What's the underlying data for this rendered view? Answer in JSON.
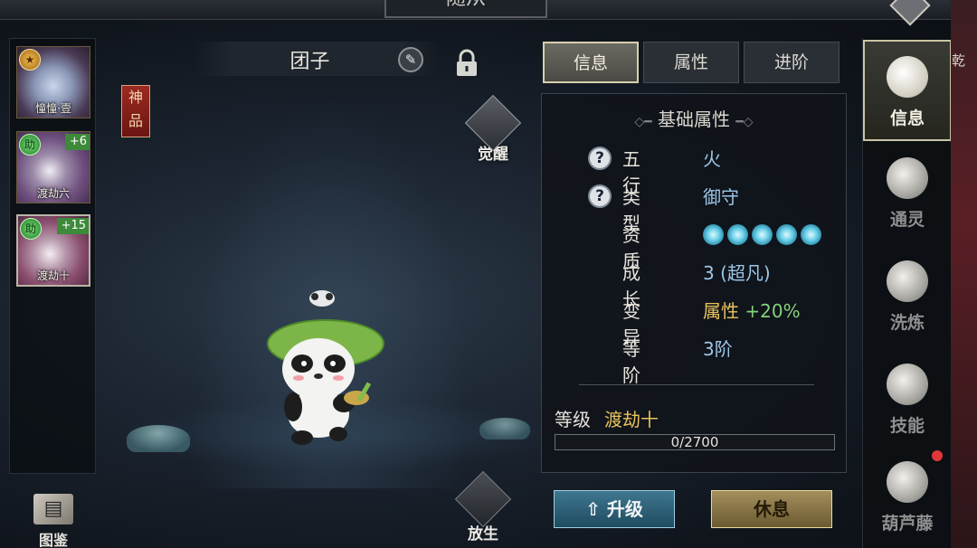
{
  "window_title": "随从",
  "pets": [
    {
      "name": "憧憧·壹",
      "plus": "",
      "badge": "icon-gold",
      "selected": false
    },
    {
      "name": "渡劫六",
      "plus": "+6",
      "badge": "助",
      "selected": false
    },
    {
      "name": "渡劫十",
      "plus": "+15",
      "badge": "助",
      "selected": true
    }
  ],
  "rank_tag": "神品",
  "pet_name": "团子",
  "awaken_label": "觉醒",
  "release_label": "放生",
  "atlas_label": "图鉴",
  "tabs": [
    {
      "label": "信息",
      "active": true
    },
    {
      "label": "属性",
      "active": false
    },
    {
      "label": "进阶",
      "active": false
    }
  ],
  "info": {
    "section_title": "基础属性",
    "rows": [
      {
        "label": "五行",
        "value": "火",
        "help": true
      },
      {
        "label": "类型",
        "value": "御守",
        "help": true
      },
      {
        "label": "资质",
        "value_icons": 5,
        "help": false
      },
      {
        "label": "成长",
        "value": "3 (超凡)",
        "help": false
      },
      {
        "label": "变异",
        "value": "属性",
        "value_extra": "+20%",
        "help": false
      },
      {
        "label": "等阶",
        "value": "3阶",
        "help": false
      }
    ],
    "level_label": "等级",
    "level_value": "渡劫十",
    "xp_text": "0/2700",
    "xp_fraction": 0
  },
  "buttons": {
    "upgrade": "升级",
    "rest": "休息"
  },
  "nav": [
    {
      "label": "信息",
      "active": true,
      "dot": false
    },
    {
      "label": "通灵",
      "active": false,
      "dot": false
    },
    {
      "label": "洗炼",
      "active": false,
      "dot": false
    },
    {
      "label": "技能",
      "active": false,
      "dot": false
    },
    {
      "label": "葫芦藤",
      "active": false,
      "dot": true
    }
  ],
  "edge_text": "乾",
  "colors": {
    "value_blue": "#9cc7e8",
    "bonus_green": "#84d17a",
    "level_gold": "#e7c35c"
  }
}
